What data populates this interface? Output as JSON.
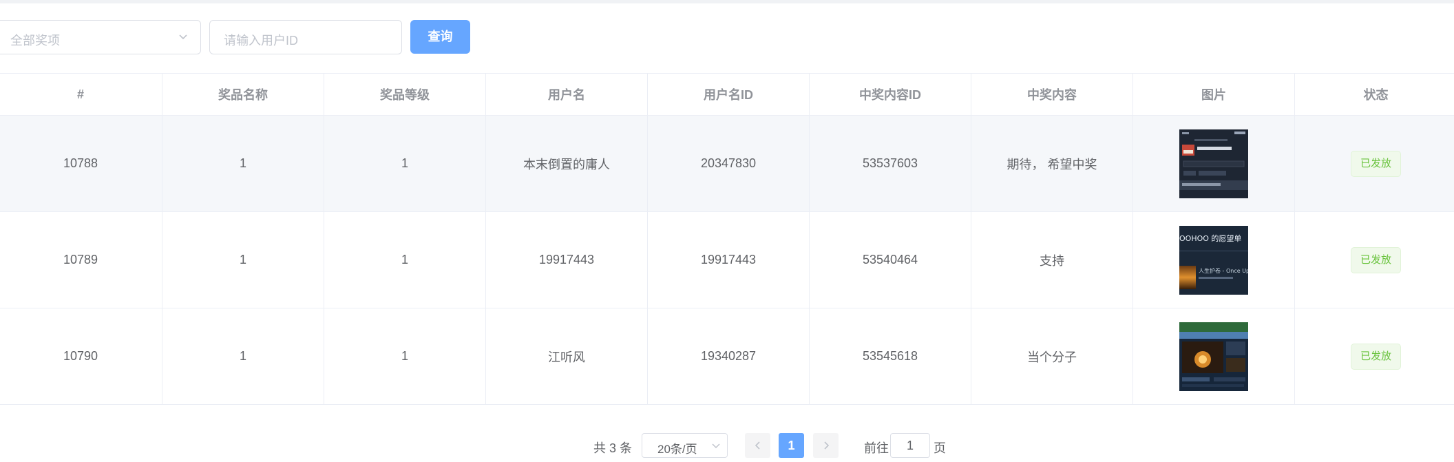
{
  "filters": {
    "prize_select_value": "全部奖项",
    "user_id_placeholder": "请输入用户ID",
    "query_label": "查询"
  },
  "table": {
    "headers": [
      "#",
      "奖品名称",
      "奖品等级",
      "用户名",
      "用户名ID",
      "中奖内容ID",
      "中奖内容",
      "图片",
      "状态"
    ],
    "rows": [
      {
        "id": "10788",
        "prize_name": "1",
        "prize_level": "1",
        "username": "本末倒置的庸人",
        "user_id": "20347830",
        "content_id": "53537603",
        "content": "期待， 希望中奖",
        "status": "已发放"
      },
      {
        "id": "10789",
        "prize_name": "1",
        "prize_level": "1",
        "username": "19917443",
        "user_id": "19917443",
        "content_id": "53540464",
        "content": "支持",
        "status": "已发放"
      },
      {
        "id": "10790",
        "prize_name": "1",
        "prize_level": "1",
        "username": "江听风",
        "user_id": "19340287",
        "content_id": "53545618",
        "content": "当个分子",
        "status": "已发放"
      }
    ]
  },
  "thumb_texts": {
    "row2_title": "OOHOO 的愿望单",
    "row2_sub": "人生护卷 - Once Up"
  },
  "pagination": {
    "total": "共 3 条",
    "page_size": "20条/页",
    "current_page": "1",
    "goto_label": "前往",
    "goto_value": "1",
    "page_unit": "页"
  },
  "colors": {
    "primary": "#66a6ff",
    "success": "#67c23a",
    "border": "#dcdfe6"
  }
}
